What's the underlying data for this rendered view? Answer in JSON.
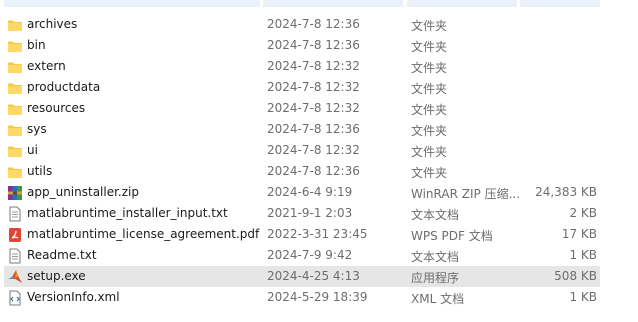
{
  "files": [
    {
      "name": "archives",
      "date": "2024-7-8 12:36",
      "type": "文件夹",
      "size": "",
      "icon": "folder-icon"
    },
    {
      "name": "bin",
      "date": "2024-7-8 12:36",
      "type": "文件夹",
      "size": "",
      "icon": "folder-icon"
    },
    {
      "name": "extern",
      "date": "2024-7-8 12:32",
      "type": "文件夹",
      "size": "",
      "icon": "folder-icon"
    },
    {
      "name": "productdata",
      "date": "2024-7-8 12:32",
      "type": "文件夹",
      "size": "",
      "icon": "folder-icon"
    },
    {
      "name": "resources",
      "date": "2024-7-8 12:32",
      "type": "文件夹",
      "size": "",
      "icon": "folder-icon"
    },
    {
      "name": "sys",
      "date": "2024-7-8 12:36",
      "type": "文件夹",
      "size": "",
      "icon": "folder-icon"
    },
    {
      "name": "ui",
      "date": "2024-7-8 12:32",
      "type": "文件夹",
      "size": "",
      "icon": "folder-icon"
    },
    {
      "name": "utils",
      "date": "2024-7-8 12:36",
      "type": "文件夹",
      "size": "",
      "icon": "folder-icon"
    },
    {
      "name": "app_uninstaller.zip",
      "date": "2024-6-4 9:19",
      "type": "WinRAR ZIP 压缩...",
      "size": "24,383 KB",
      "icon": "winrar-archive-icon"
    },
    {
      "name": "matlabruntime_installer_input.txt",
      "date": "2021-9-1 2:03",
      "type": "文本文档",
      "size": "2 KB",
      "icon": "text-file-icon"
    },
    {
      "name": "matlabruntime_license_agreement.pdf",
      "date": "2022-3-31 23:45",
      "type": "WPS PDF 文档",
      "size": "17 KB",
      "icon": "pdf-file-icon"
    },
    {
      "name": "Readme.txt",
      "date": "2024-7-9 9:42",
      "type": "文本文档",
      "size": "1 KB",
      "icon": "text-file-icon"
    },
    {
      "name": "setup.exe",
      "date": "2024-4-25 4:13",
      "type": "应用程序",
      "size": "508 KB",
      "icon": "matlab-setup-icon",
      "selected": true
    },
    {
      "name": "VersionInfo.xml",
      "date": "2024-5-29 18:39",
      "type": "XML 文档",
      "size": "1 KB",
      "icon": "xml-file-icon"
    }
  ]
}
